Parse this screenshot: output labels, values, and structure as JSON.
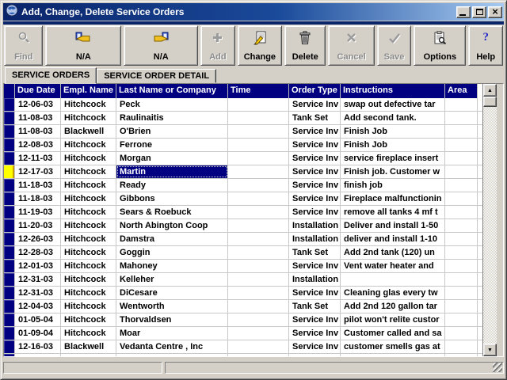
{
  "window": {
    "title": "Add, Change, Delete Service Orders"
  },
  "titlebar": {
    "icon": "globe-app-icon",
    "controls": [
      {
        "name": "minimize-button",
        "icon": "minimize-icon"
      },
      {
        "name": "maximize-button",
        "icon": "maximize-icon"
      },
      {
        "name": "close-button",
        "icon": "close-icon"
      }
    ]
  },
  "toolbar": {
    "buttons": [
      {
        "name": "find-button",
        "label": "Find",
        "icon": "find-icon",
        "enabled": false,
        "w": "w-find"
      },
      {
        "name": "prev-button",
        "label": "N/A",
        "icon": "hand-prev-icon",
        "enabled": true,
        "w": "w-prev"
      },
      {
        "name": "next-button",
        "label": "N/A",
        "icon": "hand-next-icon",
        "enabled": true,
        "w": "w-next"
      },
      {
        "name": "add-button",
        "label": "Add",
        "icon": "add-icon",
        "enabled": false,
        "w": "w-add"
      },
      {
        "name": "change-button",
        "label": "Change",
        "icon": "change-icon",
        "enabled": true,
        "w": "w-change"
      },
      {
        "name": "delete-button",
        "label": "Delete",
        "icon": "delete-icon",
        "enabled": true,
        "w": "w-delete"
      },
      {
        "name": "cancel-button",
        "label": "Cancel",
        "icon": "cancel-icon",
        "enabled": false,
        "w": "w-cancel"
      },
      {
        "name": "save-button",
        "label": "Save",
        "icon": "save-icon",
        "enabled": false,
        "w": "w-save"
      },
      {
        "name": "options-button",
        "label": "Options",
        "icon": "options-icon",
        "enabled": true,
        "w": "w-options"
      },
      {
        "name": "help-button",
        "label": "Help",
        "icon": "help-icon",
        "enabled": true,
        "w": "w-help"
      }
    ]
  },
  "tabs": [
    {
      "label": "SERVICE ORDERS",
      "active": true
    },
    {
      "label": "SERVICE ORDER DETAIL",
      "active": false
    }
  ],
  "grid": {
    "columns": [
      {
        "key": "marker",
        "label": ""
      },
      {
        "key": "due_date",
        "label": "Due Date"
      },
      {
        "key": "empl_name",
        "label": "Empl. Name"
      },
      {
        "key": "last_name",
        "label": "Last Name or Company"
      },
      {
        "key": "time",
        "label": "Time"
      },
      {
        "key": "order_type",
        "label": "Order Type"
      },
      {
        "key": "instructions",
        "label": "Instructions"
      },
      {
        "key": "area",
        "label": "Area"
      }
    ],
    "selected_row": 5,
    "selected_column": "last_name",
    "rows": [
      {
        "due_date": "12-06-03",
        "empl_name": "Hitchcock",
        "last_name": "Peck",
        "time": "",
        "order_type": "Service Inv",
        "instructions": "swap out defective tar",
        "area": ""
      },
      {
        "due_date": "11-08-03",
        "empl_name": "Hitchcock",
        "last_name": "Raulinaitis",
        "time": "",
        "order_type": "Tank Set",
        "instructions": "Add second tank.",
        "area": ""
      },
      {
        "due_date": "11-08-03",
        "empl_name": "Blackwell",
        "last_name": "O'Brien",
        "time": "",
        "order_type": "Service Inv",
        "instructions": "Finish Job",
        "area": ""
      },
      {
        "due_date": "12-08-03",
        "empl_name": "Hitchcock",
        "last_name": "Ferrone",
        "time": "",
        "order_type": "Service Inv",
        "instructions": "Finish Job",
        "area": ""
      },
      {
        "due_date": "12-11-03",
        "empl_name": "Hitchcock",
        "last_name": "Morgan",
        "time": "",
        "order_type": "Service Inv",
        "instructions": "service fireplace insert",
        "area": ""
      },
      {
        "due_date": "12-17-03",
        "empl_name": "Hitchcock",
        "last_name": "Martin",
        "time": "",
        "order_type": "Service Inv",
        "instructions": "Finish job. Customer w",
        "area": ""
      },
      {
        "due_date": "11-18-03",
        "empl_name": "Hitchcock",
        "last_name": "Ready",
        "time": "",
        "order_type": "Service Inv",
        "instructions": "finish job",
        "area": ""
      },
      {
        "due_date": "11-18-03",
        "empl_name": "Hitchcock",
        "last_name": "Gibbons",
        "time": "",
        "order_type": "Service Inv",
        "instructions": "Fireplace malfunctionin",
        "area": ""
      },
      {
        "due_date": "11-19-03",
        "empl_name": "Hitchcock",
        "last_name": "Sears & Roebuck",
        "time": "",
        "order_type": "Service Inv",
        "instructions": "remove all tanks 4 mf t",
        "area": ""
      },
      {
        "due_date": "11-20-03",
        "empl_name": "Hitchcock",
        "last_name": "North Abington Coop",
        "time": "",
        "order_type": "Installation",
        "instructions": "Deliver and install 1-50",
        "area": ""
      },
      {
        "due_date": "12-26-03",
        "empl_name": "Hitchcock",
        "last_name": "Damstra",
        "time": "",
        "order_type": "Installation",
        "instructions": "deliver and install 1-10",
        "area": ""
      },
      {
        "due_date": "12-28-03",
        "empl_name": "Hitchcock",
        "last_name": "Goggin",
        "time": "",
        "order_type": "Tank Set",
        "instructions": "Add 2nd tank (120) un",
        "area": ""
      },
      {
        "due_date": "12-01-03",
        "empl_name": "Hitchcock",
        "last_name": "Mahoney",
        "time": "",
        "order_type": "Service Inv",
        "instructions": "Vent water heater and",
        "area": ""
      },
      {
        "due_date": "12-31-03",
        "empl_name": "Hitchcock",
        "last_name": "Kelleher",
        "time": "",
        "order_type": "Installation",
        "instructions": "",
        "area": ""
      },
      {
        "due_date": "12-31-03",
        "empl_name": "Hitchcock",
        "last_name": "DiCesare",
        "time": "",
        "order_type": "Service Inv",
        "instructions": "Cleaning glas every tw",
        "area": ""
      },
      {
        "due_date": "12-04-03",
        "empl_name": "Hitchcock",
        "last_name": "Wentworth",
        "time": "",
        "order_type": "Tank Set",
        "instructions": "Add 2nd 120 gallon tar",
        "area": ""
      },
      {
        "due_date": "01-05-04",
        "empl_name": "Hitchcock",
        "last_name": "Thorvaldsen",
        "time": "",
        "order_type": "Service Inv",
        "instructions": "pilot won't relite custor",
        "area": ""
      },
      {
        "due_date": "01-09-04",
        "empl_name": "Hitchcock",
        "last_name": "Moar",
        "time": "",
        "order_type": "Service Inv",
        "instructions": "Customer called and sa",
        "area": ""
      },
      {
        "due_date": "12-16-03",
        "empl_name": "Blackwell",
        "last_name": "Vedanta Centre , Inc",
        "time": "",
        "order_type": "Service Inv",
        "instructions": "customer smells gas at",
        "area": ""
      }
    ]
  },
  "scrollbar": {
    "up_glyph": "▲",
    "down_glyph": "▼"
  },
  "statusbar": {
    "panel1": "",
    "panel2": ""
  },
  "colors": {
    "chrome": "#d4d0c8",
    "header_navy": "#000080",
    "titlebar_start": "#0a246a",
    "titlebar_end": "#a6caf0",
    "selected_marker": "#ffff00",
    "disabled_text": "#8a8a8a",
    "gridline": "#c8c8c8"
  }
}
